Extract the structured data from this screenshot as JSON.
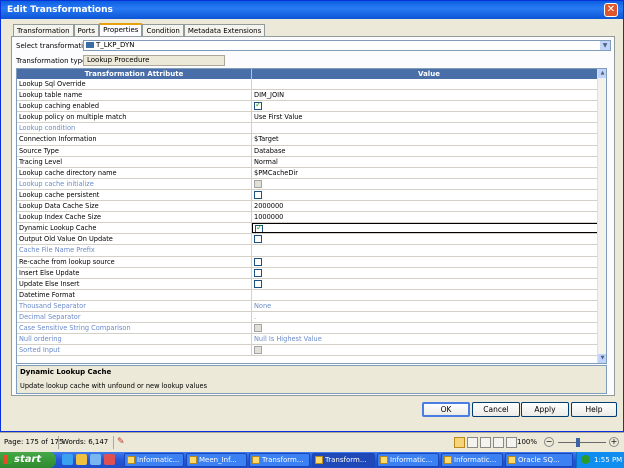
{
  "window": {
    "title": "Edit Transformations"
  },
  "tabs": [
    {
      "label": "Transformation",
      "active": false
    },
    {
      "label": "Ports",
      "active": false
    },
    {
      "label": "Properties",
      "active": true
    },
    {
      "label": "Condition",
      "active": false
    },
    {
      "label": "Metadata Extensions",
      "active": false
    }
  ],
  "select": {
    "label": "Select transformation:",
    "value": "T_LKP_DYN"
  },
  "type": {
    "label": "Transformation type:",
    "value": "Lookup Procedure"
  },
  "grid": {
    "headers": {
      "attribute": "Transformation Attribute",
      "value": "Value"
    },
    "rows": [
      {
        "attribute": "Lookup Sql Override",
        "value": "",
        "checkbox": null,
        "disabled": false
      },
      {
        "attribute": "Lookup table name",
        "value": "DIM_JOIN",
        "checkbox": null,
        "disabled": false
      },
      {
        "attribute": "Lookup caching enabled",
        "value": "",
        "checkbox": "checked",
        "disabled": false
      },
      {
        "attribute": "Lookup policy on multiple match",
        "value": "Use First Value",
        "checkbox": null,
        "disabled": false
      },
      {
        "attribute": "Lookup condition",
        "value": "",
        "checkbox": null,
        "disabled": true
      },
      {
        "attribute": "Connection Information",
        "value": "$Target",
        "checkbox": null,
        "disabled": false
      },
      {
        "attribute": "Source Type",
        "value": "Database",
        "checkbox": null,
        "disabled": false
      },
      {
        "attribute": "Tracing Level",
        "value": "Normal",
        "checkbox": null,
        "disabled": false
      },
      {
        "attribute": "Lookup cache directory name",
        "value": "$PMCacheDir",
        "checkbox": null,
        "disabled": false
      },
      {
        "attribute": "Lookup cache initialize",
        "value": "",
        "checkbox": "disabled",
        "disabled": true
      },
      {
        "attribute": "Lookup cache persistent",
        "value": "",
        "checkbox": "unchecked",
        "disabled": false
      },
      {
        "attribute": "Lookup Data Cache Size",
        "value": "2000000",
        "checkbox": null,
        "disabled": false
      },
      {
        "attribute": "Lookup Index Cache Size",
        "value": "1000000",
        "checkbox": null,
        "disabled": false
      },
      {
        "attribute": "Dynamic Lookup Cache",
        "value": "",
        "checkbox": "checked",
        "disabled": false,
        "selected": true
      },
      {
        "attribute": "Output Old Value On Update",
        "value": "",
        "checkbox": "unchecked",
        "disabled": false
      },
      {
        "attribute": "Cache File Name Prefix",
        "value": "",
        "checkbox": null,
        "disabled": true
      },
      {
        "attribute": "Re-cache from lookup source",
        "value": "",
        "checkbox": "unchecked",
        "disabled": false
      },
      {
        "attribute": "Insert Else Update",
        "value": "",
        "checkbox": "unchecked",
        "disabled": false
      },
      {
        "attribute": "Update Else Insert",
        "value": "",
        "checkbox": "unchecked",
        "disabled": false
      },
      {
        "attribute": "Datetime Format",
        "value": "",
        "checkbox": null,
        "disabled": false
      },
      {
        "attribute": "Thousand Separator",
        "value": "None",
        "checkbox": null,
        "disabled": true
      },
      {
        "attribute": "Decimal Separator",
        "value": ".",
        "checkbox": null,
        "disabled": true
      },
      {
        "attribute": "Case Sensitive String Comparison",
        "value": "",
        "checkbox": "disabled",
        "disabled": true
      },
      {
        "attribute": "Null ordering",
        "value": "Null Is Highest Value",
        "checkbox": null,
        "disabled": true
      },
      {
        "attribute": "Sorted Input",
        "value": "",
        "checkbox": "disabled",
        "disabled": true
      }
    ]
  },
  "description": {
    "title": "Dynamic Lookup Cache",
    "text": "Update lookup cache with unfound or new lookup values"
  },
  "buttons": {
    "ok": "OK",
    "cancel": "Cancel",
    "apply": "Apply",
    "help": "Help"
  },
  "statusbar": {
    "page": "Page: 175 of 175",
    "words": "Words: 6,147",
    "zoom": "100%"
  },
  "taskbar": {
    "start": "start",
    "tasks": [
      "Informatic...",
      "Meen_Inf...",
      "Transform...",
      "Transform...",
      "Informatic...",
      "Informatic...",
      "Oracle SQ..."
    ],
    "clock": "1:55 PM"
  },
  "colors": {
    "title_blue": "#0a5ee0",
    "grid_header": "#4a6fa8",
    "disabled_text": "#6b8ac9",
    "check_green": "#21a121"
  }
}
